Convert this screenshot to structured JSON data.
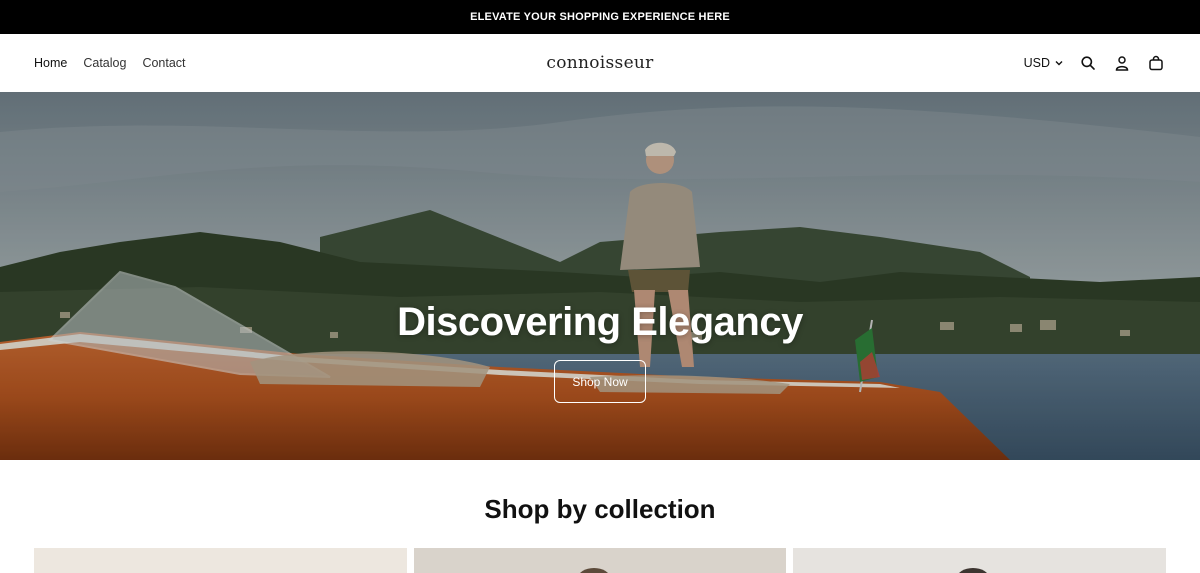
{
  "announcement": {
    "text": "ELEVATE YOUR SHOPPING EXPERIENCE HERE"
  },
  "nav": {
    "items": [
      {
        "label": "Home"
      },
      {
        "label": "Catalog"
      },
      {
        "label": "Contact"
      }
    ]
  },
  "brand": {
    "logo": "connoisseur"
  },
  "tools": {
    "currency": "USD",
    "icons": [
      "search-icon",
      "account-icon",
      "cart-icon"
    ]
  },
  "hero": {
    "title": "Discovering Elegancy",
    "button_label": "Shop Now"
  },
  "collections": {
    "title": "Shop by collection",
    "cards": [
      {
        "color": "#ede7df"
      },
      {
        "color": "#d9d3cb"
      },
      {
        "color": "#e6e3df"
      }
    ]
  },
  "colors": {
    "announcement_bg": "#000000",
    "page_bg": "#ffffff",
    "text": "#111111"
  }
}
